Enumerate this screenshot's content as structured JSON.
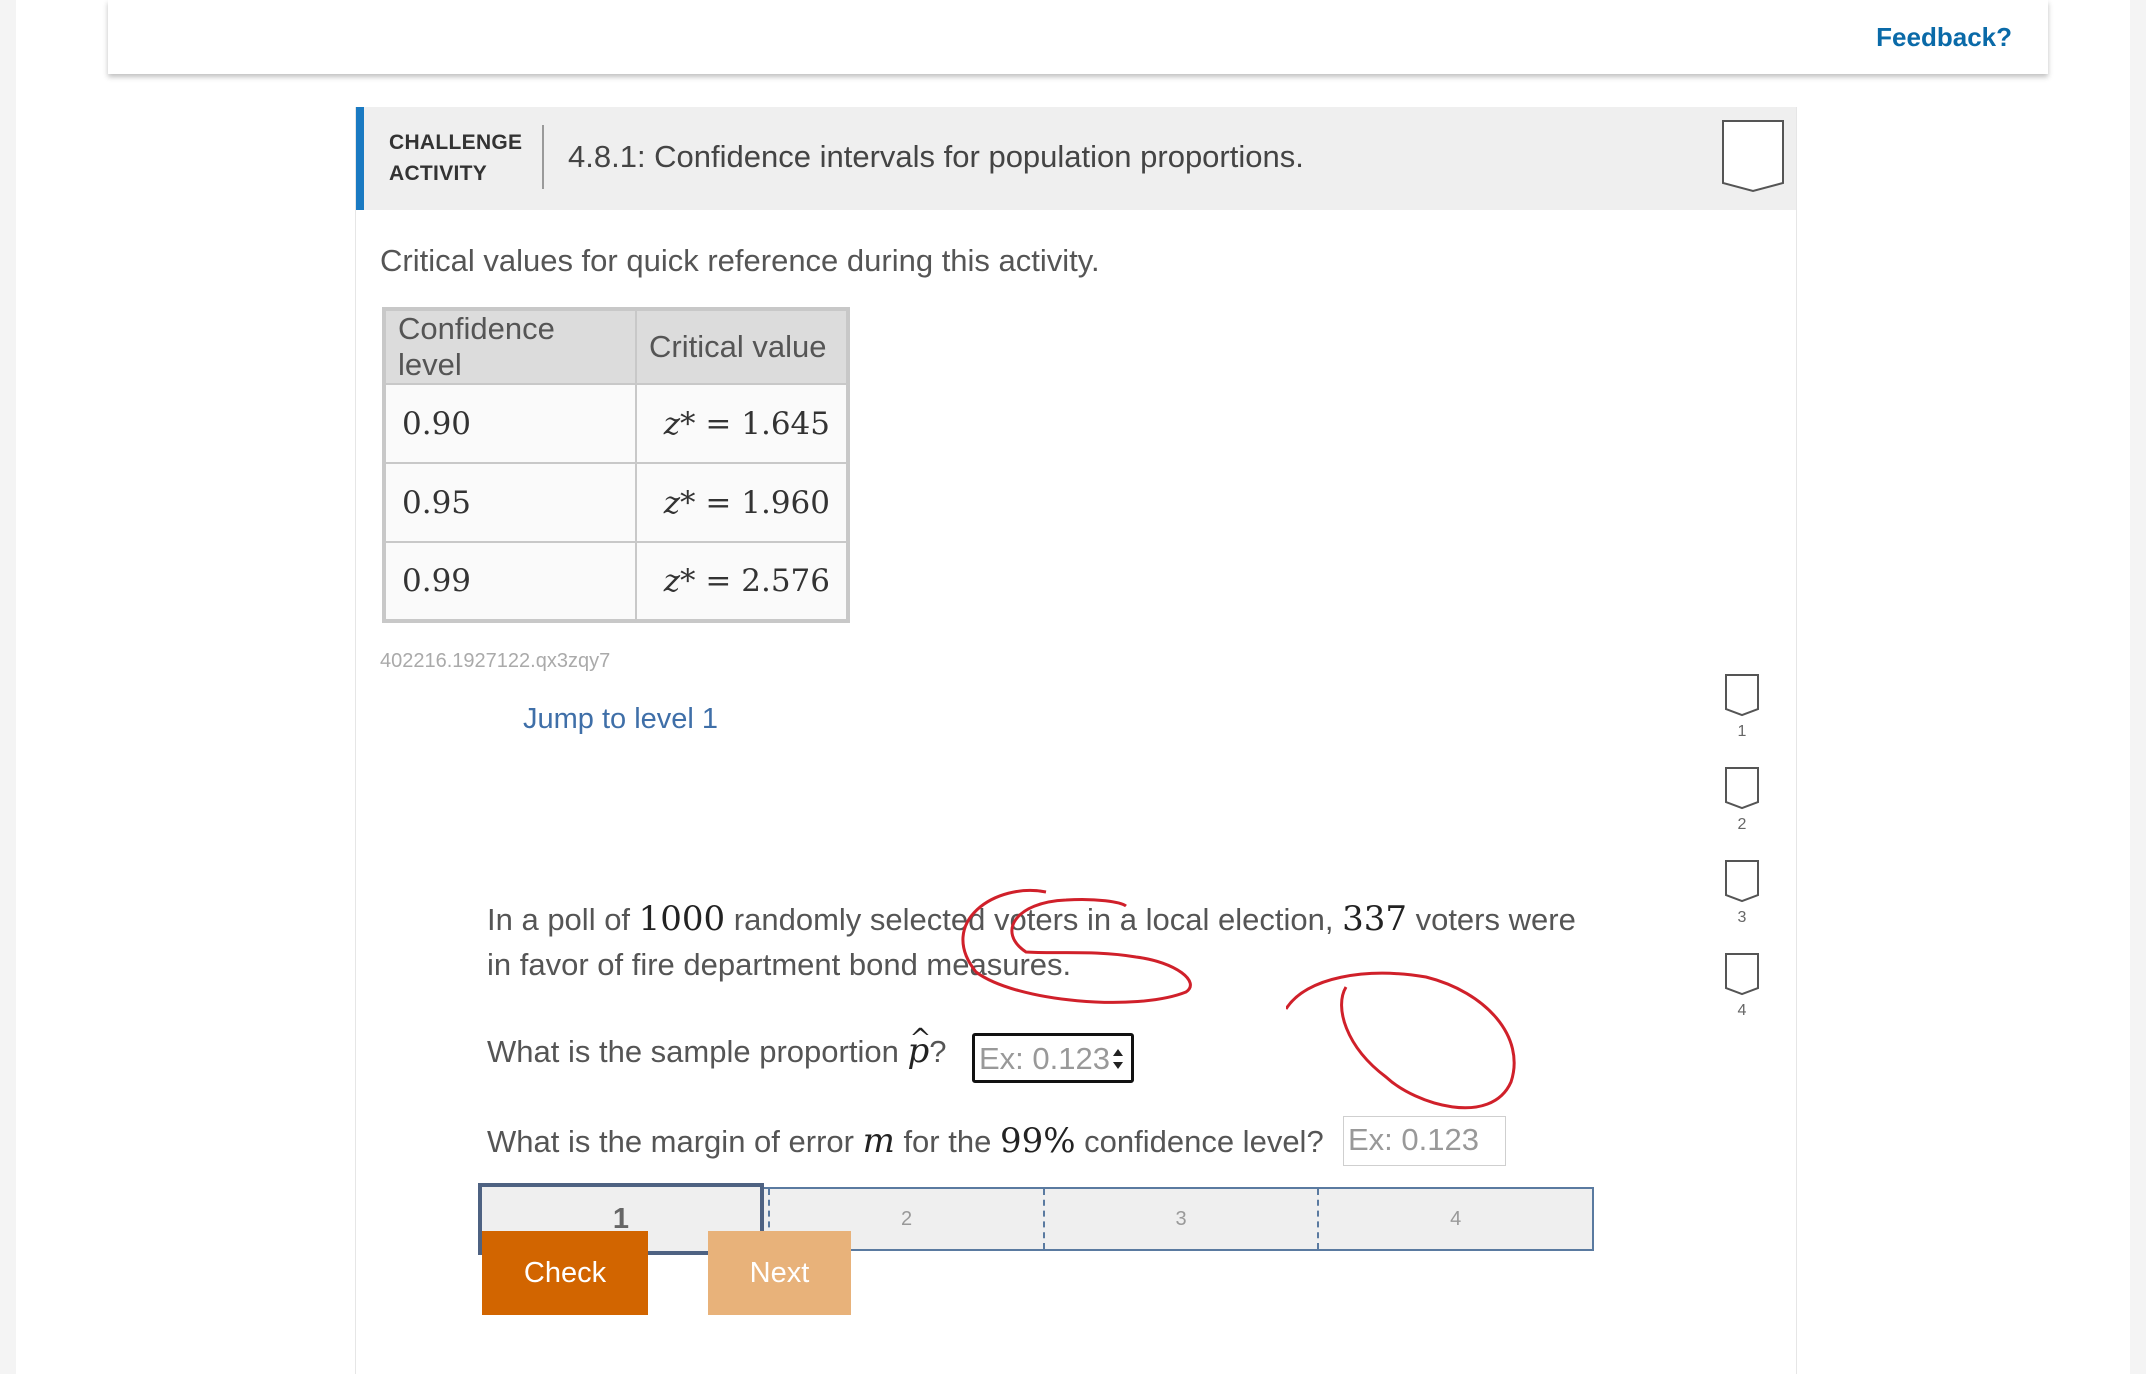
{
  "header": {
    "feedback_label": "Feedback?"
  },
  "activity": {
    "type_line1": "CHALLENGE",
    "type_line2": "ACTIVITY",
    "title": "4.8.1: Confidence intervals for population proportions.",
    "intro": "Critical values for quick reference during this activity.",
    "table": {
      "headers": [
        "Confidence level",
        "Critical value"
      ],
      "rows": [
        {
          "level": "0.90",
          "zvar": "z*",
          "eq": "=",
          "value": "1.645"
        },
        {
          "level": "0.95",
          "zvar": "z*",
          "eq": "=",
          "value": "1.960"
        },
        {
          "level": "0.99",
          "zvar": "z*",
          "eq": "=",
          "value": "2.576"
        }
      ]
    },
    "activity_id": "402216.1927122.qx3zqy7",
    "jump_link": "Jump to level 1",
    "question": {
      "text_a": "In a poll of ",
      "n_voters": "1000",
      "text_b": " randomly selected voters in a local election, ",
      "favor": "337",
      "text_c": " voters were in favor of fire department bond measures."
    },
    "q_sample": {
      "text_a": "What is the sample proportion ",
      "symbol": "p",
      "text_b": "?",
      "placeholder": "Ex: 0.123"
    },
    "q_margin": {
      "text_a": "What is the margin of error ",
      "symbol": "m",
      "text_b": " for the ",
      "level": "99%",
      "text_c": " confidence level?",
      "placeholder": "Ex: 0.123"
    },
    "levels": {
      "current": "1",
      "segments": [
        "2",
        "3",
        "4"
      ]
    },
    "buttons": {
      "check": "Check",
      "next": "Next"
    },
    "steps": [
      "1",
      "2",
      "3",
      "4"
    ]
  },
  "colors": {
    "accent_blue": "#1a7ac2",
    "check_orange": "#d26500",
    "next_orange_disabled": "#e8b27a",
    "annotation_red": "#d0202a"
  }
}
